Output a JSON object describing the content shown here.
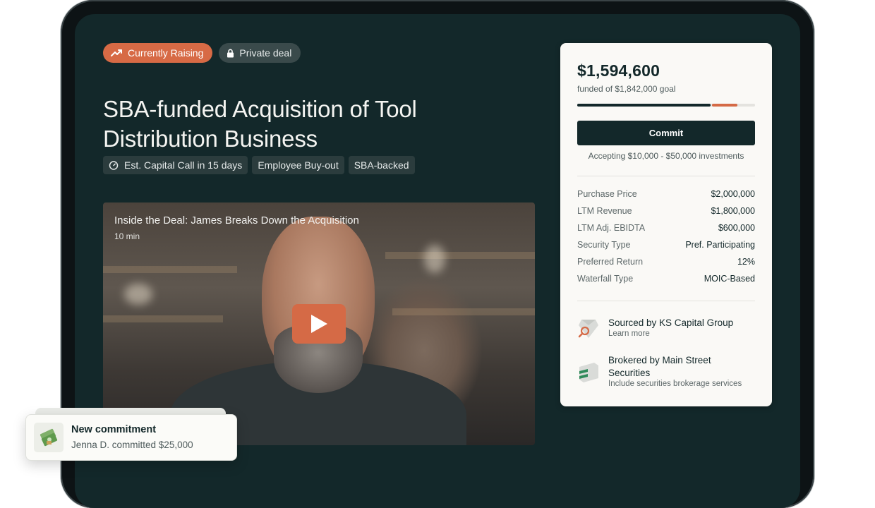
{
  "badges": {
    "raising": "Currently Raising",
    "private": "Private deal"
  },
  "deal": {
    "title": "SBA-funded Acquisition of Tool Distribution Business"
  },
  "tags": [
    "Est. Capital Call in 15 days",
    "Employee Buy-out",
    "SBA-backed"
  ],
  "video": {
    "title": "Inside the Deal: James Breaks Down the Acquisition",
    "duration": "10 min"
  },
  "funding": {
    "amount": "$1,594,600",
    "goal_text": "funded of $1,842,000 goal",
    "funded_fraction": 0.75,
    "pending_fraction": 0.15,
    "commit_label": "Commit",
    "accepting": "Accepting $10,000 - $50,000 investments"
  },
  "stats": [
    {
      "label": "Purchase Price",
      "value": "$2,000,000"
    },
    {
      "label": "LTM Revenue",
      "value": "$1,800,000"
    },
    {
      "label": "LTM Adj. EBIDTA",
      "value": "$600,000"
    },
    {
      "label": "Security Type",
      "value": "Pref. Participating"
    },
    {
      "label": "Preferred Return",
      "value": "12%"
    },
    {
      "label": "Waterfall Type",
      "value": "MOIC-Based"
    }
  ],
  "partners": {
    "sourced": {
      "name": "Sourced by KS Capital Group",
      "sub": "Learn more"
    },
    "brokered": {
      "name": "Brokered by Main Street Securities",
      "sub": "Include securities brokerage services"
    }
  },
  "toast": {
    "title": "New commitment",
    "text": "Jenna D. committed $25,000"
  },
  "colors": {
    "accent": "#d56a46",
    "dark": "#13282a",
    "card": "#faf9f6"
  }
}
